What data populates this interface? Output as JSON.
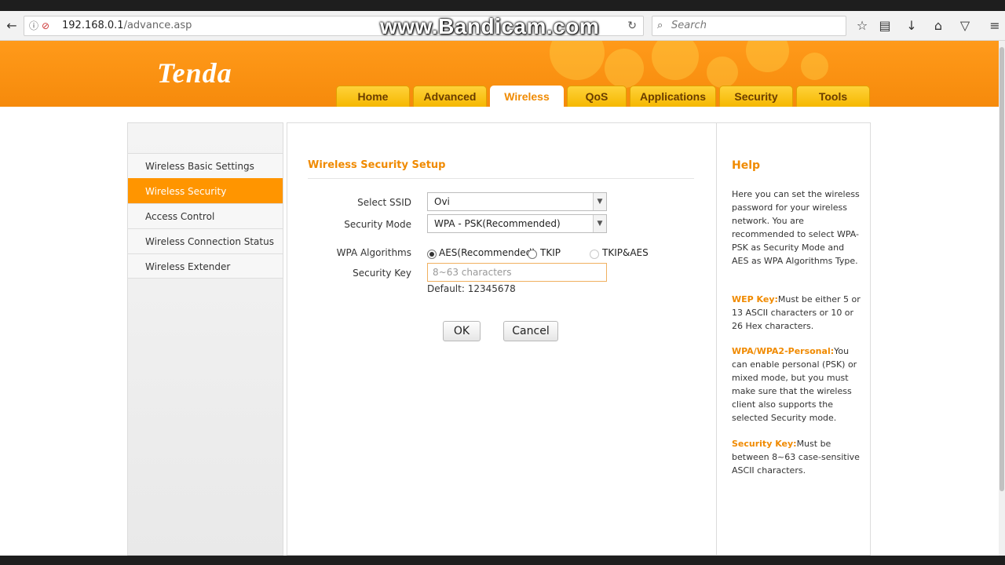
{
  "browser": {
    "url_host": "192.168.0.1",
    "url_path": "/advance.asp",
    "search_placeholder": "Search",
    "watermark": "www.Bandicam.com"
  },
  "brand": {
    "logo": "Tenda",
    "accent": "#f68a0b"
  },
  "tabs": [
    {
      "label": "Home"
    },
    {
      "label": "Advanced"
    },
    {
      "label": "Wireless"
    },
    {
      "label": "QoS"
    },
    {
      "label": "Applications"
    },
    {
      "label": "Security"
    },
    {
      "label": "Tools"
    }
  ],
  "active_tab": "Wireless",
  "sidebar": {
    "items": [
      {
        "label": "Wireless Basic Settings"
      },
      {
        "label": "Wireless Security"
      },
      {
        "label": "Access Control"
      },
      {
        "label": "Wireless Connection Status"
      },
      {
        "label": "Wireless Extender"
      }
    ],
    "active": "Wireless Security"
  },
  "form": {
    "title": "Wireless Security Setup",
    "ssid_label": "Select SSID",
    "ssid_value": "Ovi",
    "mode_label": "Security Mode",
    "mode_value": "WPA - PSK(Recommended)",
    "algo_label": "WPA Algorithms",
    "algo_options": [
      "AES(Recommended)",
      "TKIP",
      "TKIP&AES"
    ],
    "algo_selected": "AES(Recommended)",
    "key_label": "Security Key",
    "key_placeholder": "8~63 characters",
    "default_text": "Default: 12345678",
    "ok_label": "OK",
    "cancel_label": "Cancel"
  },
  "help": {
    "title": "Help",
    "intro": "Here you can set the wireless password for your wireless network. You are recommended to select WPA-PSK as Security Mode and AES as WPA Algorithms Type.",
    "wep_key": "WEP Key:",
    "wep_text": "Must be either 5 or 13 ASCII characters or 10 or 26 Hex characters.",
    "wpa_key": "WPA/WPA2-Personal:",
    "wpa_text": "You can enable personal (PSK) or mixed mode, but you must make sure that the wireless client also supports the selected Security mode.",
    "sec_key": "Security Key:",
    "sec_text": "Must be between 8~63 case-sensitive ASCII characters."
  }
}
